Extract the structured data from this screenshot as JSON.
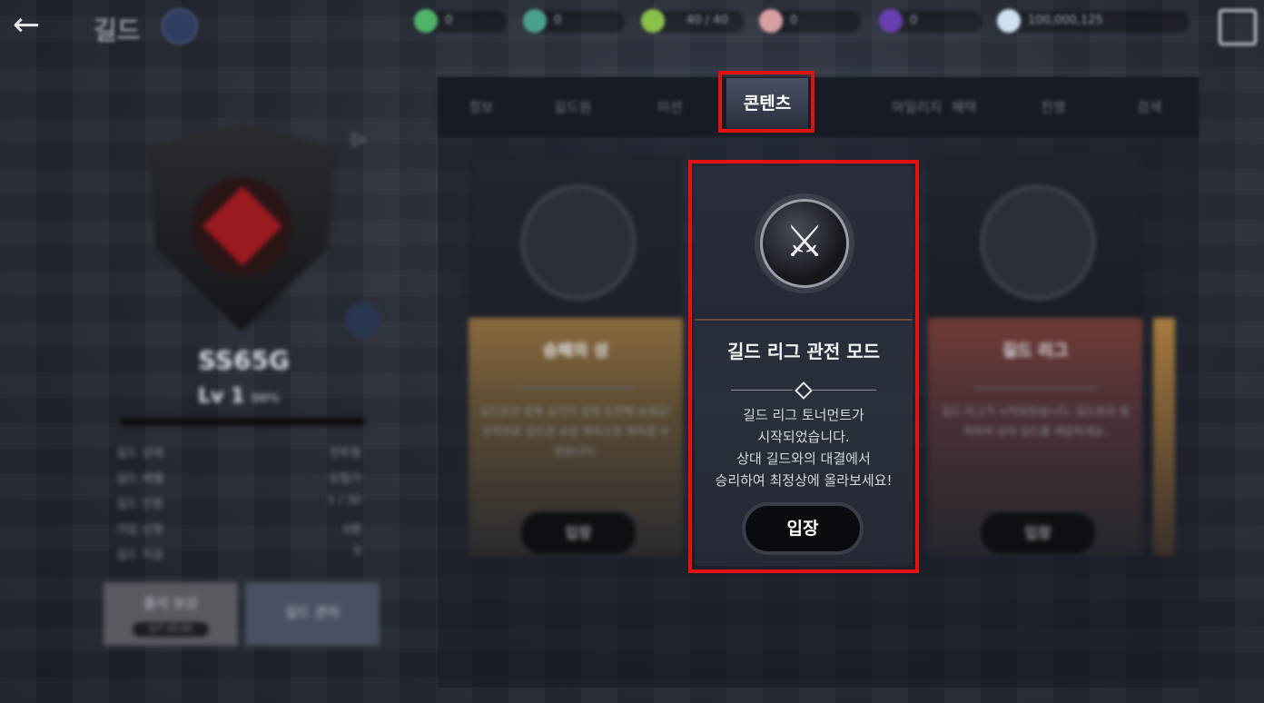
{
  "topbar": {
    "title": "길드",
    "currencies": [
      {
        "icon": "green-gem-icon",
        "value": "0",
        "color": "#4fb46a"
      },
      {
        "icon": "teal-gem-icon",
        "value": "0",
        "color": "#4aa090"
      },
      {
        "icon": "green-coin-icon",
        "value": "40 / 40",
        "color": "#8ac04a"
      },
      {
        "icon": "pink-orb-icon",
        "value": "0",
        "color": "#d8a0a0"
      },
      {
        "icon": "purple-gem-icon",
        "value": "0",
        "color": "#6a3fb0"
      },
      {
        "icon": "diamond-icon",
        "value": "100,000,125",
        "color": "#cfe0f0"
      }
    ]
  },
  "guild": {
    "name": "SS65G",
    "level": "Lv 1",
    "level_percent": "00%",
    "stats": [
      {
        "key": "길드 상태",
        "value": "전투형"
      },
      {
        "key": "길드 레벨",
        "value": "모험가"
      },
      {
        "key": "길드 인원",
        "value": "1 / 30"
      },
      {
        "key": "가입 신청",
        "value": "0명"
      },
      {
        "key": "길드 자금",
        "value": "0"
      }
    ],
    "buttons": [
      {
        "label": "출석 보상",
        "sub": "0/7 00:00"
      },
      {
        "label": "길드 관리"
      }
    ]
  },
  "tabs": [
    "정보",
    "길드원",
    "미션",
    "콘텐츠",
    "마일리지",
    "혜택",
    "전쟁",
    "검색"
  ],
  "active_tab": "콘텐츠",
  "cards": {
    "left": {
      "title": "승패의 성",
      "desc": "길드원과 함께 승리의 성에 도전해 보세요! 무작위로 길드원 보상 획득으로 획득할 수 있습니다.",
      "enter_label": "입장"
    },
    "center": {
      "title": "길드 리그 관전 모드",
      "desc_lines": [
        "길드 리그 토너먼트가",
        "시작되었습니다.",
        "상대 길드와의 대결에서",
        "승리하여 최정상에 올라보세요!"
      ],
      "enter_label": "입장"
    },
    "right": {
      "title": "길드 리그",
      "desc": "길드 리그가 시작되었습니다. 길드원과 협력하여 상대 길드를 제압하세요.",
      "enter_label": "입장"
    }
  },
  "colors": {
    "highlight": "#e3120f",
    "card_left_accent": "#8a6a3e",
    "card_right_accent": "#6e3b35"
  }
}
